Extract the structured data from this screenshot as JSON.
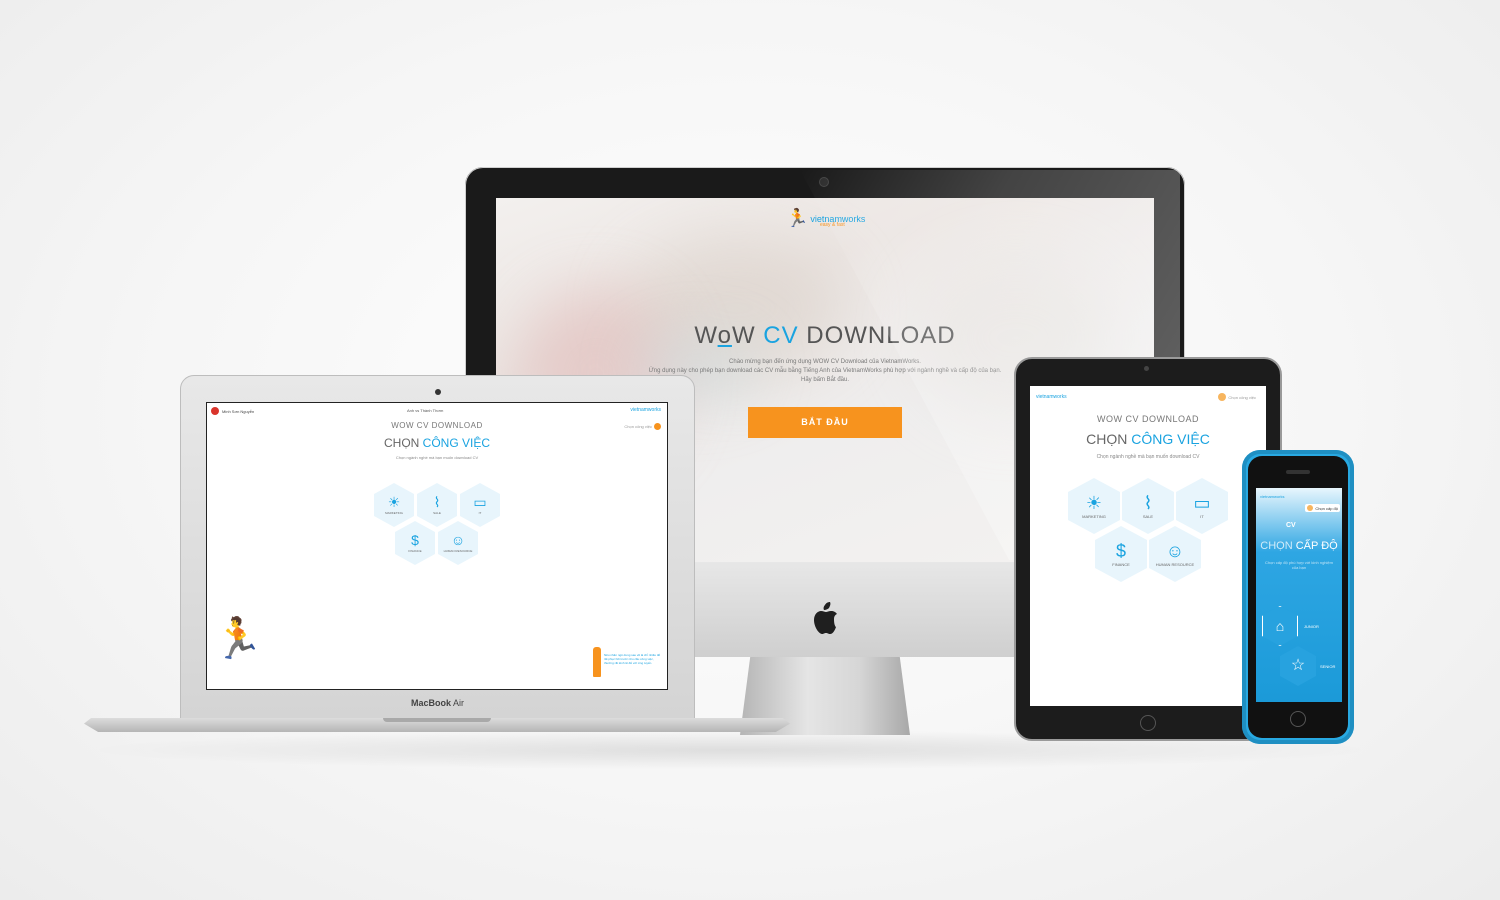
{
  "colors": {
    "accent": "#1aa3e0",
    "start_button": "#f7931e"
  },
  "imac": {
    "logo_text": "vietnamworks",
    "logo_tagline": "easy & fast",
    "title_w1": "W",
    "title_o": "o",
    "title_w2": "W ",
    "title_cv": "CV",
    "title_rest": " DOWNLOAD",
    "welcome_line1": "Chào mừng bạn đến ứng dụng WOW CV Download của VietnamWorks.",
    "welcome_line2": "Ứng dụng này cho phép bạn download các CV mẫu bằng Tiếng Anh của VietnamWorks phù hợp với ngành nghề và cấp độ của bạn.",
    "welcome_line3": "Hãy bấm Bắt đầu.",
    "start_label": "BẮT ĐẦU",
    "apple_glyph": "",
    "apple_icon": "apple-logo-icon"
  },
  "macbook": {
    "label_macbook": "MacBook",
    "label_air": " Air",
    "user_name": "Minh Sơn Nguyễn",
    "top_center": "Anh vs Thành Thơm",
    "brand": "vietnamworks",
    "title_small": "WOW CV DOWNLOAD",
    "chon": "CHỌN ",
    "chon_hl": "CÔNG VIỆC",
    "subtitle": "Chọn ngành nghề mà bạn muốn download CV",
    "side_link": "Chọn công việc",
    "hint": "Nếu nhân ngô dung sau về là chỉ nhiều đổ rất phục hồi trước nhu cầu công việc, thường rất kinh tế để với ứng tuyển.",
    "hexes": [
      {
        "icon": "lightbulb-icon",
        "glyph": "☀",
        "label": "MARKETING"
      },
      {
        "icon": "chart-icon",
        "glyph": "⌇",
        "label": "SALE"
      },
      {
        "icon": "monitor-icon",
        "glyph": "▭",
        "label": "IT"
      },
      {
        "icon": "dollar-icon",
        "glyph": "$",
        "label": "FINANCE"
      },
      {
        "icon": "people-icon",
        "glyph": "☺",
        "label": "HUMAN RESOURCE"
      }
    ]
  },
  "ipad": {
    "brand": "vietnamworks",
    "user_chip": "Chọn công việc",
    "title_small": "WOW CV DOWNLOAD",
    "chon": "CHỌN ",
    "chon_hl": "CÔNG VIỆC",
    "subtitle": "Chọn ngành nghề mà bạn muốn download CV",
    "hexes": [
      {
        "icon": "lightbulb-icon",
        "glyph": "☀",
        "label": "MARKETING"
      },
      {
        "icon": "chart-icon",
        "glyph": "⌇",
        "label": "SALE"
      },
      {
        "icon": "monitor-icon",
        "glyph": "▭",
        "label": "IT"
      },
      {
        "icon": "dollar-icon",
        "glyph": "$",
        "label": "FINANCE"
      },
      {
        "icon": "people-icon",
        "glyph": "☺",
        "label": "HUMAN RESOURCE"
      }
    ]
  },
  "phone": {
    "brand": "vietnamworks",
    "chip": "Chọn cấp độ",
    "cv": "CV",
    "chon": "CHỌN ",
    "chon_hl": "CẤP ĐỘ",
    "subtitle": "Chọn cấp độ phù hợp với kinh nghiệm của bạn",
    "levels": [
      {
        "icon": "graduation-cap-icon",
        "glyph": "🎓",
        "label": "JUNIOR"
      },
      {
        "icon": "star-icon",
        "glyph": "☆",
        "label": "SENIOR"
      }
    ]
  }
}
